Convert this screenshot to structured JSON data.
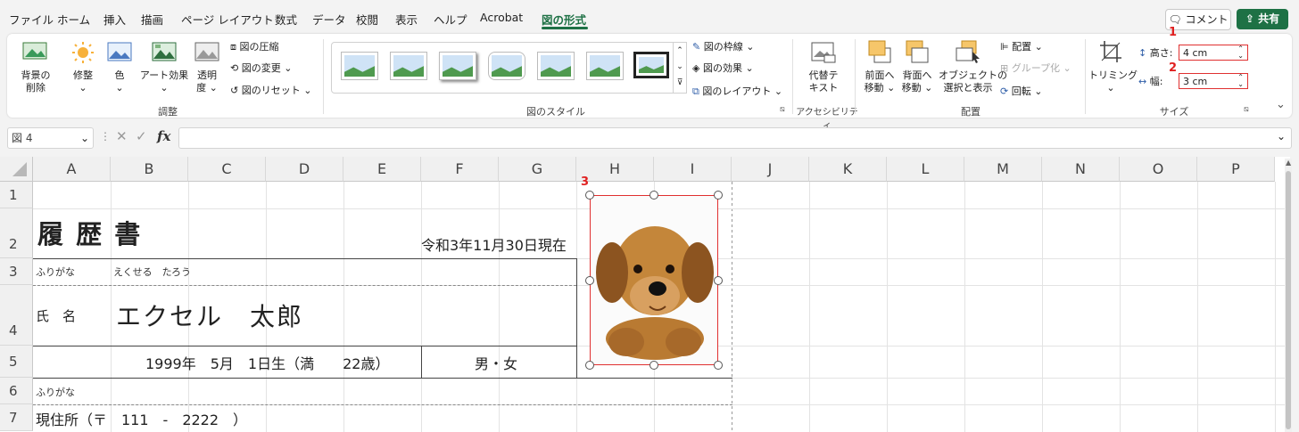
{
  "menu": {
    "items": [
      "ファイル",
      "ホーム",
      "挿入",
      "描画",
      "ページ レイアウト",
      "数式",
      "データ",
      "校閲",
      "表示",
      "ヘルプ",
      "Acrobat",
      "図の形式"
    ],
    "comment": "コメント",
    "share": "共有"
  },
  "ribbon": {
    "adjust": {
      "bg_remove": [
        "背景の",
        "削除"
      ],
      "corrections": "修整",
      "color": "色",
      "artistic": "アート効果",
      "transparency": [
        "透明",
        "度"
      ],
      "compress": "図の圧縮",
      "change": "図の変更",
      "reset": "図のリセット",
      "group": "調整"
    },
    "styles": {
      "border": "図の枠線",
      "effects": "図の効果",
      "layout": "図のレイアウト",
      "group": "図のスタイル"
    },
    "accessibility": {
      "alt_text": [
        "代替テ",
        "キスト"
      ],
      "group": "アクセシビリティ"
    },
    "arrange": {
      "bring_forward": [
        "前面へ",
        "移動"
      ],
      "send_backward": [
        "背面へ",
        "移動"
      ],
      "selection_pane": [
        "オブジェクトの",
        "選択と表示"
      ],
      "align": "配置",
      "group_obj": "グループ化",
      "rotate": "回転",
      "group": "配置"
    },
    "size": {
      "crop": "トリミング",
      "height_label": "高さ:",
      "height_value": "4 cm",
      "width_label": "幅:",
      "width_value": "3 cm",
      "group": "サイズ"
    }
  },
  "annotations": [
    "1",
    "2",
    "3"
  ],
  "formula_bar": {
    "name_box": "図 4",
    "fx": "fx",
    "content": ""
  },
  "sheet": {
    "columns": [
      "A",
      "B",
      "C",
      "D",
      "E",
      "F",
      "G",
      "H",
      "I",
      "J",
      "K",
      "L",
      "M",
      "N",
      "O",
      "P"
    ],
    "rows": [
      "1",
      "2",
      "3",
      "4",
      "5",
      "6",
      "7"
    ],
    "resume_title": "履 歴 書",
    "date": "令和3年11月30日現在",
    "furigana_label": "ふりがな",
    "furigana_value": "えくせる　たろう",
    "name_label": "氏　名",
    "name_value": "エクセル　太郎",
    "birth": "1999年　5月　1日生（満　　22歳）",
    "gender": "男・女",
    "furigana_label2": "ふりがな",
    "address": "現住所（〒　111　-　2222　）"
  },
  "colors": {
    "accent": "#1e7145",
    "annotation": "#e02020"
  }
}
